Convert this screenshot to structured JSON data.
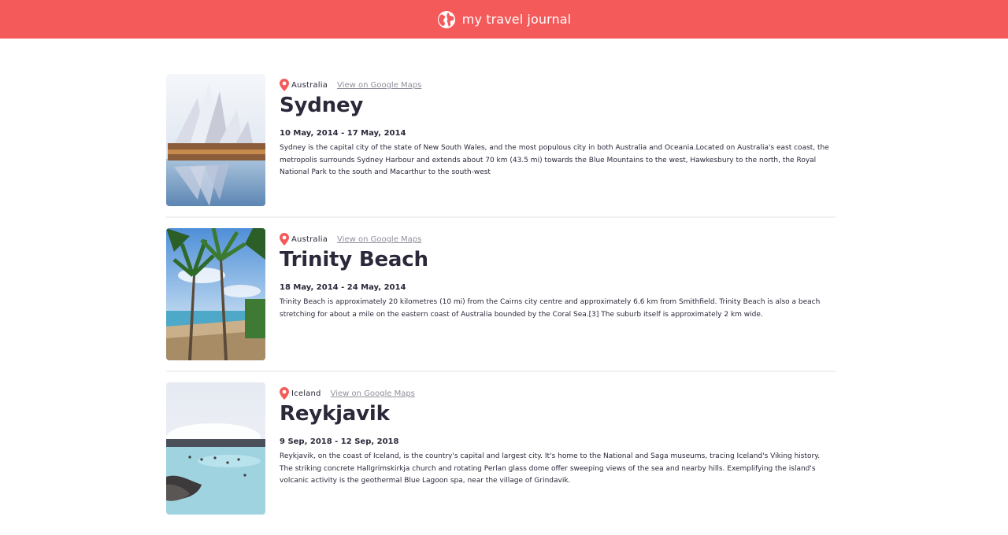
{
  "header": {
    "title": "my travel journal",
    "icon": "globe-icon"
  },
  "colors": {
    "accent": "#f55a5a",
    "text": "#2b283a",
    "link": "#918e9b",
    "divider": "#f0f0f0"
  },
  "entries": [
    {
      "country": "Australia",
      "maps_link": "View on Google Maps",
      "title": "Sydney",
      "dates": "10 May, 2014 - 17 May, 2014",
      "description": "Sydney is the capital city of the state of New South Wales, and the most populous city in both Australia and Oceania.Located on Australia's east coast, the metropolis surrounds Sydney Harbour and extends about 70 km (43.5 mi) towards the Blue Mountains to the west, Hawkesbury to the north, the Royal National Park to the south and Macarthur to the south-west",
      "photo": "sydney-opera-house-photo"
    },
    {
      "country": "Australia",
      "maps_link": "View on Google Maps",
      "title": "Trinity Beach",
      "dates": "18 May, 2014 - 24 May, 2014",
      "description": "Trinity Beach is approximately 20 kilometres (10 mi) from the Cairns city centre and approximately 6.6 km from Smithfield. Trinity Beach is also a beach stretching for about a mile on the eastern coast of Australia bounded by the Coral Sea.[3] The suburb itself is approximately 2 km wide.",
      "photo": "palm-beach-photo"
    },
    {
      "country": "Iceland",
      "maps_link": "View on Google Maps",
      "title": "Reykjavik",
      "dates": "9 Sep, 2018 - 12 Sep, 2018",
      "description": "Reykjavik, on the coast of Iceland, is the country's capital and largest city. It's home to the National and Saga museums, tracing Iceland's Viking history. The striking concrete Hallgrimskirkja church and rotating Perlan glass dome offer sweeping views of the sea and nearby hills. Exemplifying the island's volcanic activity is the geothermal Blue Lagoon spa, near the village of Grindavik.",
      "photo": "blue-lagoon-photo"
    }
  ]
}
